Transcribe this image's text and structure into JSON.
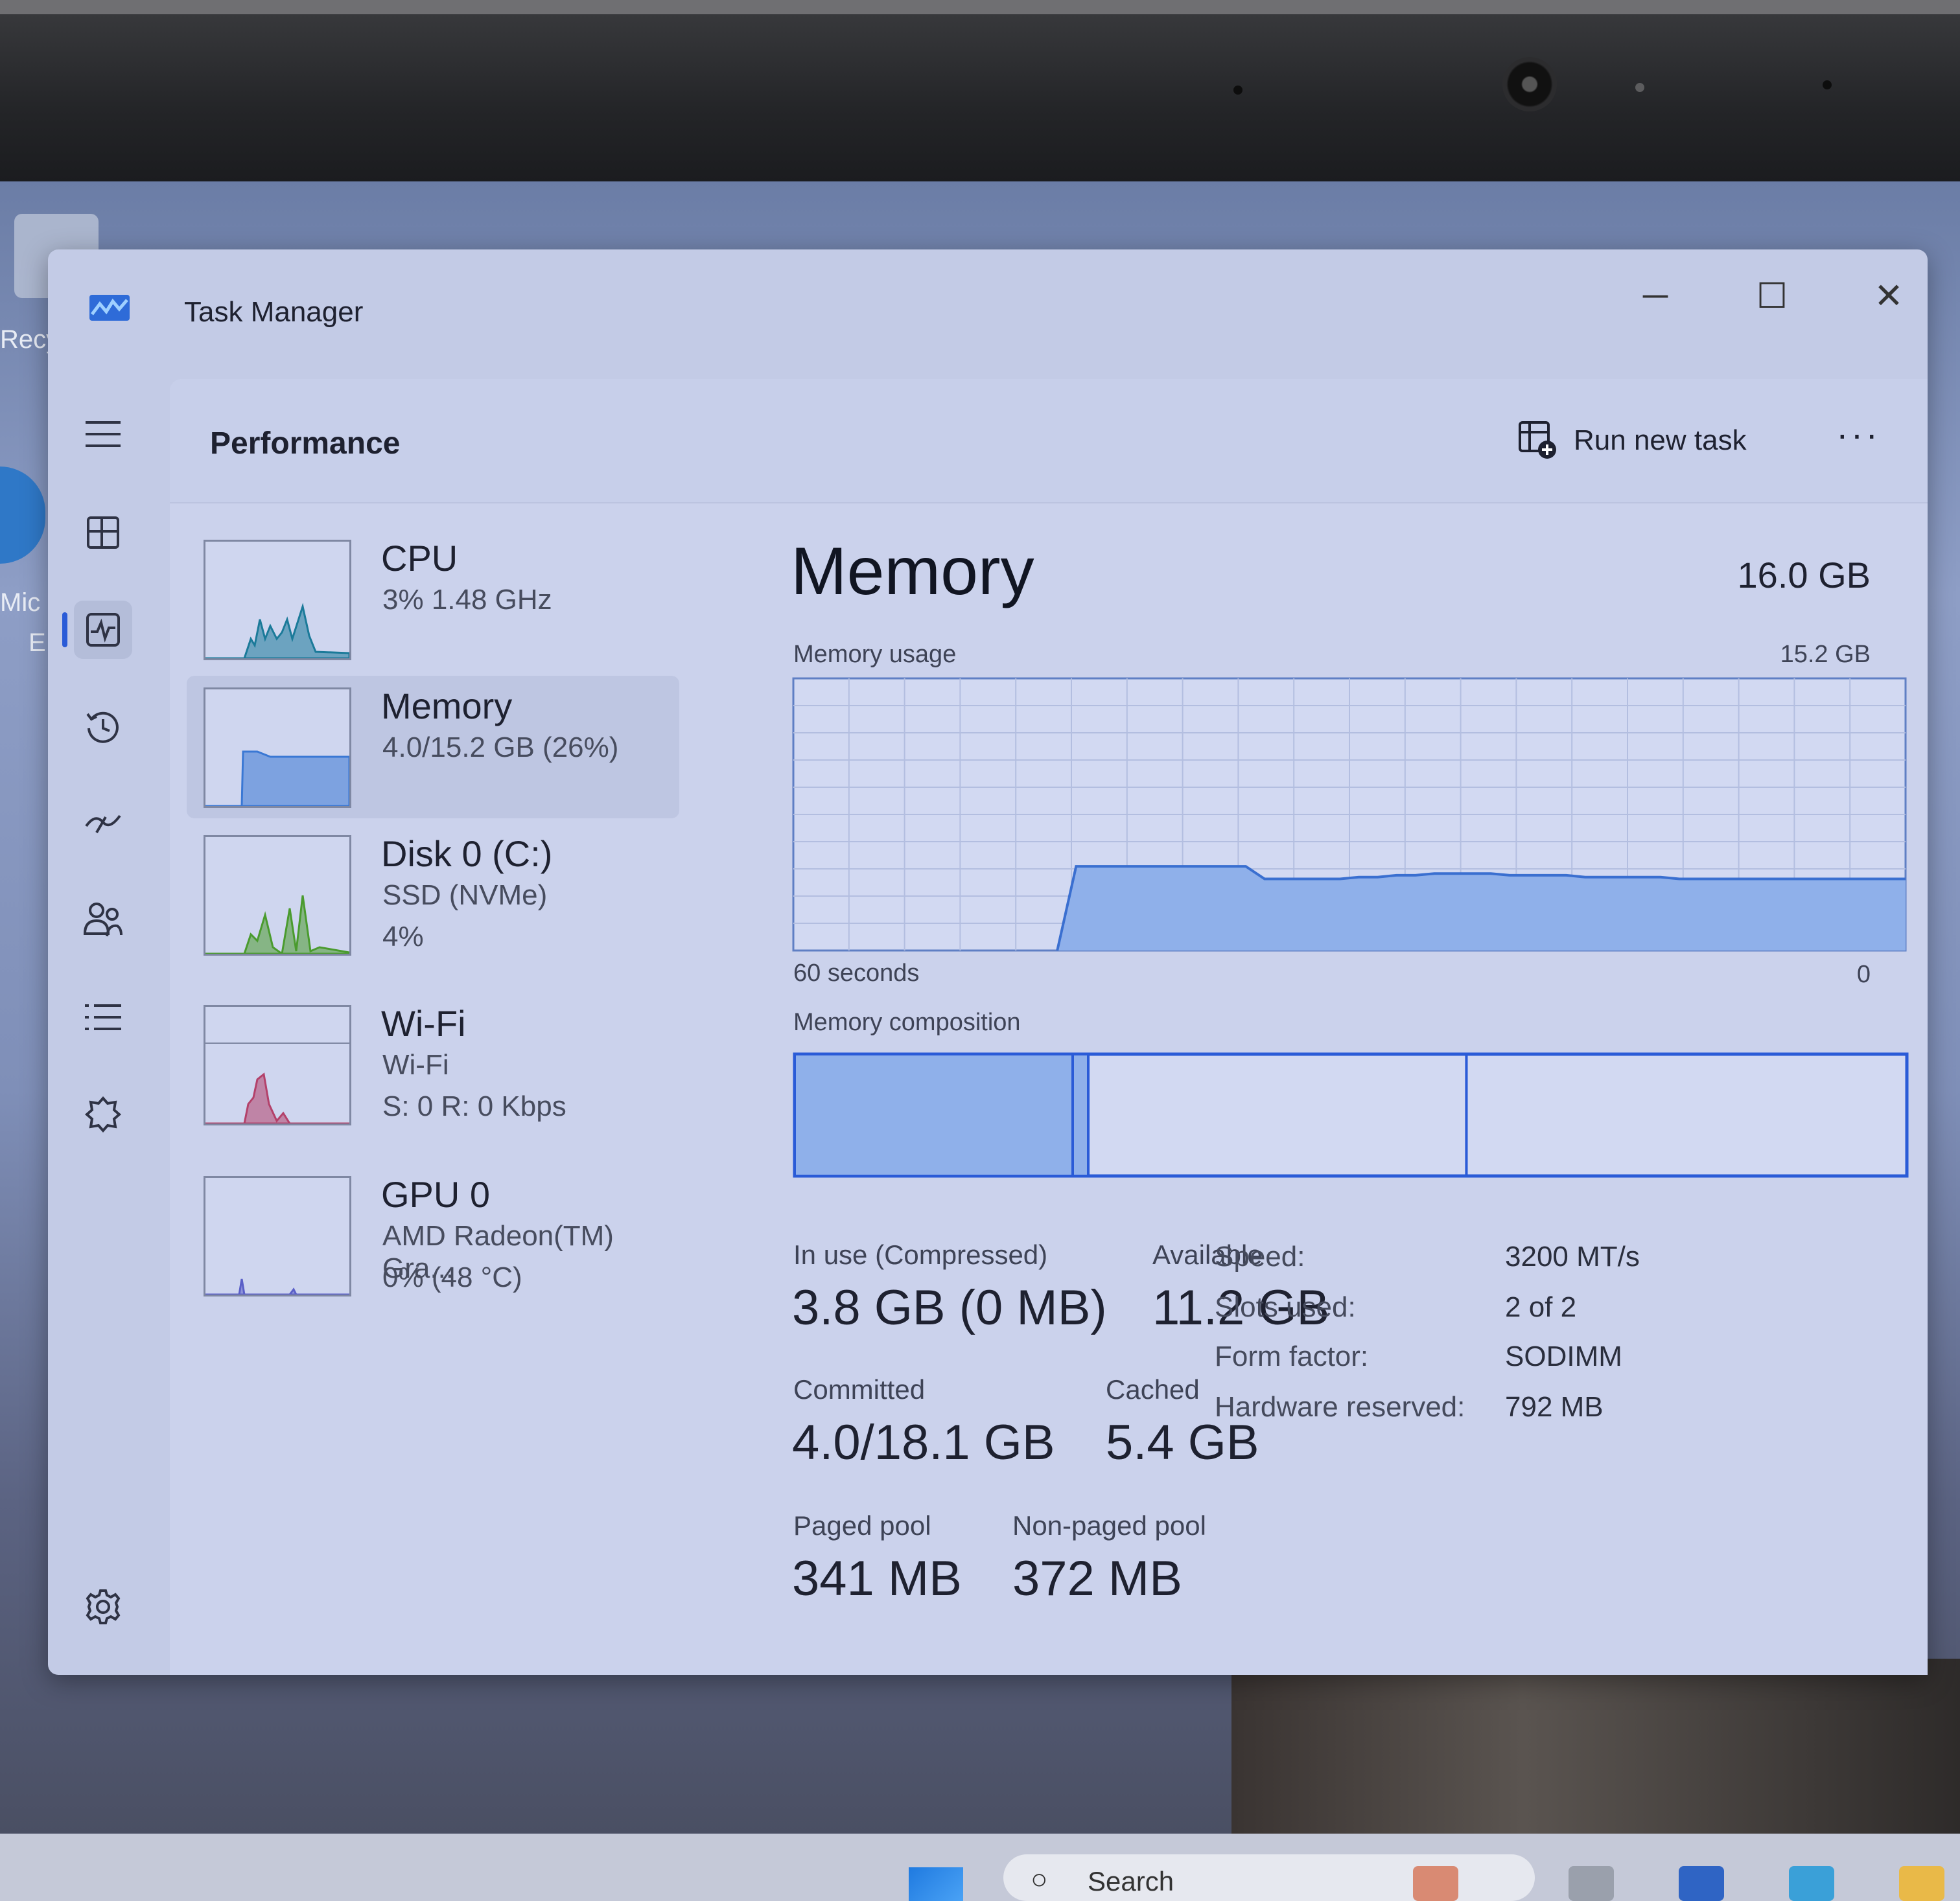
{
  "desktop": {
    "icon_label_1": "Recy",
    "icon_label_2": "Mic",
    "icon_label_3": "E"
  },
  "window": {
    "title": "Task Manager",
    "minimize": "─",
    "maximize": "☐",
    "close": "✕"
  },
  "command_bar": {
    "page_title": "Performance",
    "run_new_task": "Run new task",
    "more": "···"
  },
  "devices": [
    {
      "name": "CPU",
      "line2": "3%  1.48 GHz",
      "line3": "",
      "graph_color": "#1b7a99"
    },
    {
      "name": "Memory",
      "line2": "4.0/15.2 GB (26%)",
      "line3": "",
      "graph_color": "#3a78d4"
    },
    {
      "name": "Disk 0 (C:)",
      "line2": "SSD (NVMe)",
      "line3": "4%",
      "graph_color": "#4a9b2e"
    },
    {
      "name": "Wi-Fi",
      "line2": "Wi-Fi",
      "line3": "S: 0  R: 0 Kbps",
      "graph_color": "#b3416a"
    },
    {
      "name": "GPU 0",
      "line2": "AMD Radeon(TM) Gra...",
      "line3": "0%  (48 °C)",
      "graph_color": "#5a5fc8"
    }
  ],
  "memory": {
    "title": "Memory",
    "total": "16.0 GB",
    "usage_label": "Memory usage",
    "usage_max": "15.2 GB",
    "time_left": "60 seconds",
    "time_right": "0",
    "composition_label": "Memory composition",
    "composition": {
      "in_use_fraction": 0.25,
      "modified_fraction": 0.014,
      "standby_fraction": 0.34,
      "free_fraction": 0.396
    },
    "stats": {
      "in_use_label": "In use (Compressed)",
      "in_use_value": "3.8 GB (0 MB)",
      "available_label": "Available",
      "available_value": "11.2 GB",
      "committed_label": "Committed",
      "committed_value": "4.0/18.1 GB",
      "cached_label": "Cached",
      "cached_value": "5.4 GB",
      "paged_label": "Paged pool",
      "paged_value": "341 MB",
      "nonpaged_label": "Non-paged pool",
      "nonpaged_value": "372 MB"
    },
    "details": [
      {
        "key": "Speed:",
        "value": "3200 MT/s"
      },
      {
        "key": "Slots used:",
        "value": "2 of 2"
      },
      {
        "key": "Form factor:",
        "value": "SODIMM"
      },
      {
        "key": "Hardware reserved:",
        "value": "792 MB"
      }
    ]
  },
  "chart_data": {
    "type": "area",
    "title": "Memory usage",
    "xlabel": "",
    "ylabel": "",
    "x_range_seconds": [
      60,
      0
    ],
    "ylim_gb": [
      0,
      15.2
    ],
    "grid": true,
    "series": [
      {
        "values_gb": [
          0,
          0,
          0,
          0,
          0,
          0,
          0,
          0,
          0,
          0,
          0,
          0,
          0,
          0,
          0,
          4.7,
          4.7,
          4.7,
          4.7,
          4.7,
          4.7,
          4.7,
          4.7,
          4.7,
          4.7,
          4.0,
          4.0,
          4.0,
          4.0,
          4.0,
          4.1,
          4.1,
          4.2,
          4.2,
          4.3,
          4.3,
          4.3,
          4.3,
          4.2,
          4.2,
          4.2,
          4.2,
          4.1,
          4.1,
          4.1,
          4.1,
          4.1,
          4.0,
          4.0,
          4.0,
          4.0,
          4.0,
          4.0,
          4.0,
          4.0,
          4.0,
          4.0,
          4.0,
          4.0,
          4.0
        ]
      }
    ]
  },
  "taskbar": {
    "search_placeholder": "Search"
  },
  "colors": {
    "accent": "#2a5bd7",
    "memory_fill": "#8fb0ea",
    "memory_line": "#3a6fd0",
    "window_bg": "#c3cbe6"
  }
}
